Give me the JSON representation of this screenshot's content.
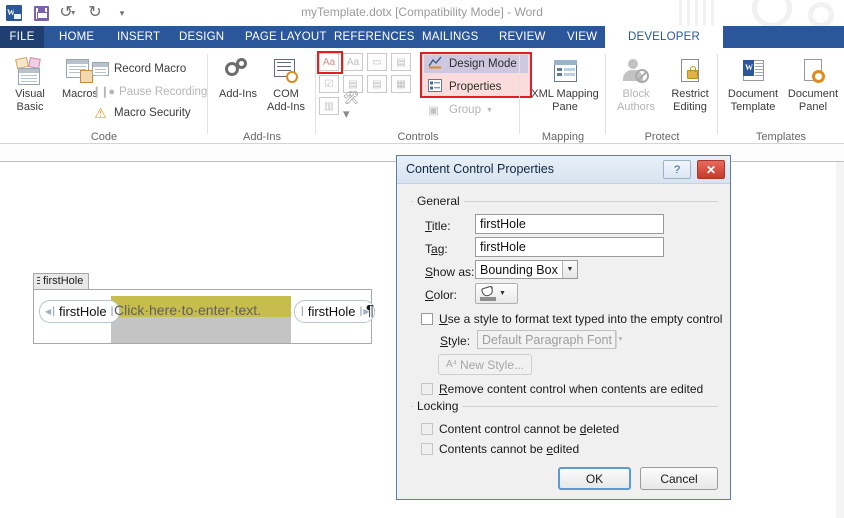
{
  "window": {
    "title": "myTemplate.dotx [Compatibility Mode] - Word",
    "quick_access": [
      {
        "name": "word-logo-icon",
        "label": "W"
      },
      {
        "name": "save-icon",
        "label": "Save"
      },
      {
        "name": "undo-icon",
        "label": "Undo"
      },
      {
        "name": "redo-icon",
        "label": "Redo"
      },
      {
        "name": "customize-qat-icon",
        "label": "Customize Quick Access Toolbar"
      }
    ]
  },
  "tabs": [
    {
      "label": "FILE",
      "active": false
    },
    {
      "label": "HOME",
      "active": false
    },
    {
      "label": "INSERT",
      "active": false
    },
    {
      "label": "DESIGN",
      "active": false
    },
    {
      "label": "PAGE LAYOUT",
      "active": false
    },
    {
      "label": "REFERENCES",
      "active": false
    },
    {
      "label": "MAILINGS",
      "active": false
    },
    {
      "label": "REVIEW",
      "active": false
    },
    {
      "label": "VIEW",
      "active": false
    },
    {
      "label": "DEVELOPER",
      "active": true
    }
  ],
  "ribbon": {
    "groups": {
      "code": {
        "label": "Code",
        "visual_basic": "Visual\nBasic",
        "visual_basic_line1": "Visual",
        "visual_basic_line2": "Basic",
        "macros": "Macros",
        "record_macro": "Record Macro",
        "pause_recording": "Pause Recording",
        "macro_security": "Macro Security"
      },
      "addins": {
        "label": "Add-Ins",
        "add_ins": "Add-Ins",
        "com_line1": "COM",
        "com_line2": "Add-Ins"
      },
      "controls": {
        "label": "Controls",
        "rich_text": "Aa",
        "plain_text": "Aa",
        "design_mode": "Design Mode",
        "properties": "Properties",
        "group": "Group",
        "design_mode_selected": true,
        "highlight_color": "#e02020"
      },
      "mapping": {
        "label": "Mapping",
        "xml_line1": "XML Mapping",
        "xml_line2": "Pane"
      },
      "protect": {
        "label": "Protect",
        "block_line1": "Block",
        "block_line2": "Authors",
        "restrict_line1": "Restrict",
        "restrict_line2": "Editing"
      },
      "templates": {
        "label": "Templates",
        "doc_template_line1": "Document",
        "doc_template_line2": "Template",
        "doc_panel_line1": "Document",
        "doc_panel_line2": "Panel"
      }
    }
  },
  "document": {
    "control_tag_label": "firstHole",
    "left_pill": "firstHole",
    "right_pill": "firstHole",
    "placeholder_text": "Click·here·to·enter·text.",
    "pilcrow": "¶",
    "highlight_color": "#c7bd4d"
  },
  "dialog": {
    "title": "Content Control Properties",
    "help_label": "?",
    "close_label": "✕",
    "general_legend": "General",
    "title_label": "Title:",
    "title_value": "firstHole",
    "tag_label": "Tag:",
    "tag_value": "firstHole",
    "show_as_label": "Show as:",
    "show_as_value": "Bounding Box",
    "color_label": "Color:",
    "use_style_label": "Use a style to format text typed into the empty control",
    "use_style_checked": false,
    "style_label": "Style:",
    "style_value": "Default Paragraph Font",
    "new_style_label": "New Style...",
    "remove_cc_label": "Remove content control when contents are edited",
    "remove_cc_checked": false,
    "locking_legend": "Locking",
    "lock_delete_label": "Content control cannot be deleted",
    "lock_delete_checked": false,
    "lock_edit_label": "Contents cannot be edited",
    "lock_edit_checked": false,
    "ok_label": "OK",
    "cancel_label": "Cancel"
  }
}
